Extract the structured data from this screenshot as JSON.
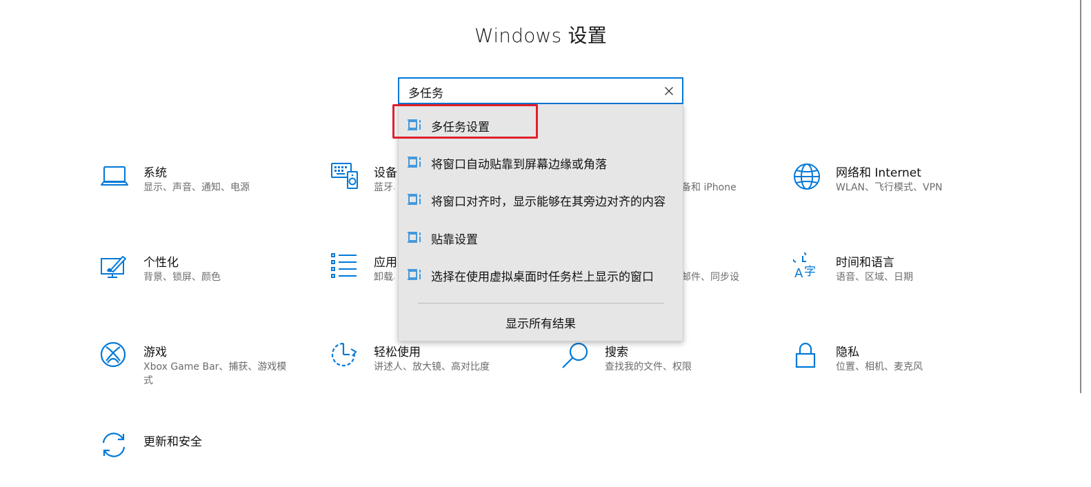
{
  "window": {
    "title": "Windows 设置"
  },
  "search": {
    "value": "多任务"
  },
  "dropdown": {
    "suggestions": [
      {
        "label": "多任务设置",
        "icon": "multitasking-icon",
        "highlighted": true
      },
      {
        "label": "将窗口自动贴靠到屏幕边缘或角落",
        "icon": "multitasking-icon"
      },
      {
        "label": "将窗口对齐时，显示能够在其旁边对齐的内容",
        "icon": "multitasking-icon"
      },
      {
        "label": "贴靠设置",
        "icon": "multitasking-icon"
      },
      {
        "label": "选择在使用虚拟桌面时任务栏上显示的窗口",
        "icon": "multitasking-icon"
      }
    ],
    "show_all": "显示所有结果"
  },
  "tiles": [
    {
      "title": "系统",
      "desc": "显示、声音、通知、电源",
      "icon": "laptop-icon"
    },
    {
      "title": "设备",
      "desc": "蓝牙、",
      "icon": "devices-icon"
    },
    {
      "title": "",
      "desc": "备和 iPhone",
      "icon": ""
    },
    {
      "title": "网络和 Internet",
      "desc": "WLAN、飞行模式、VPN",
      "icon": "globe-icon"
    },
    {
      "title": "个性化",
      "desc": "背景、锁屏、颜色",
      "icon": "personalization-icon"
    },
    {
      "title": "应用",
      "desc": "卸载、",
      "icon": "apps-icon"
    },
    {
      "title": "",
      "desc": "邮件、同步设",
      "icon": ""
    },
    {
      "title": "时间和语言",
      "desc": "语音、区域、日期",
      "icon": "time-language-icon"
    },
    {
      "title": "游戏",
      "desc": "Xbox Game Bar、捕获、游戏模式",
      "icon": "xbox-icon"
    },
    {
      "title": "轻松使用",
      "desc": "讲述人、放大镜、高对比度",
      "icon": "ease-of-access-icon"
    },
    {
      "title": "搜索",
      "desc": "查找我的文件、权限",
      "icon": "search-icon"
    },
    {
      "title": "隐私",
      "desc": "位置、相机、麦克风",
      "icon": "lock-icon"
    },
    {
      "title": "更新和安全",
      "desc": "",
      "icon": "update-icon"
    }
  ],
  "colors": {
    "accent": "#0078d7",
    "highlight_border": "#e0202a",
    "dropdown_bg": "#e6e6e6"
  }
}
